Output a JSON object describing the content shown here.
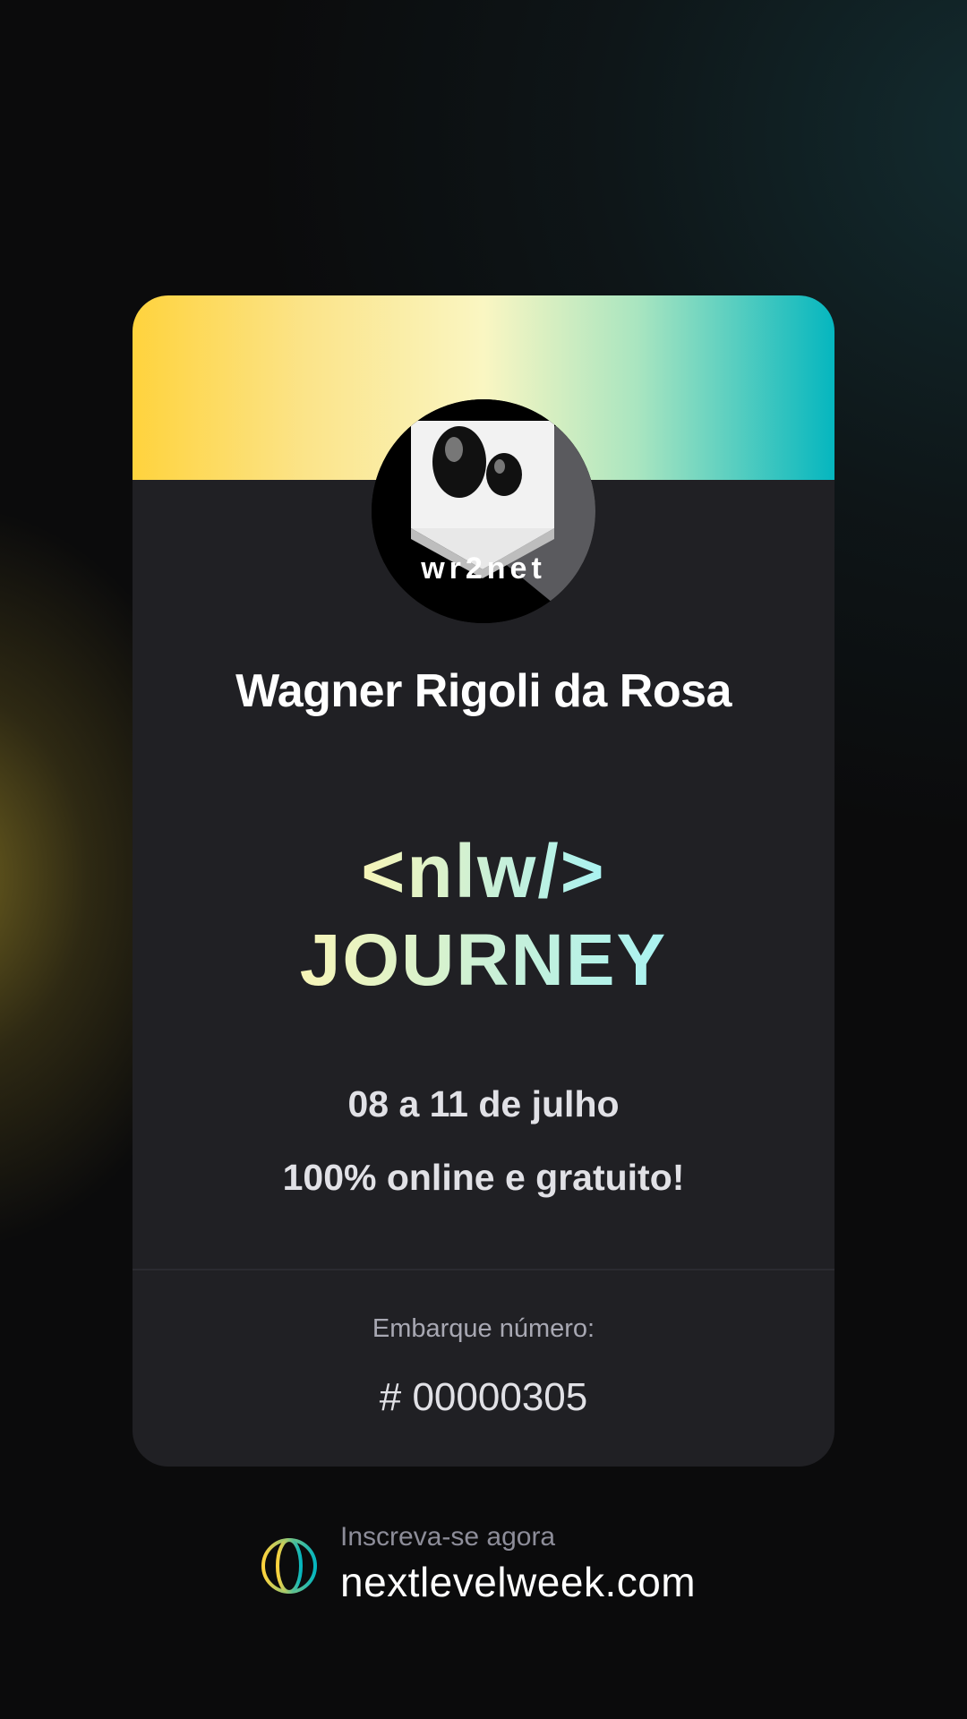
{
  "background": {
    "accent_yellow": "#FFD33D",
    "accent_teal": "#05B6BF",
    "card": "#202024"
  },
  "card": {
    "name": "Wagner Rigoli da Rosa",
    "avatar": {
      "icon": "wr2net-logo-icon",
      "text": "wr2net"
    },
    "event_logo": {
      "top": "<nlw/>",
      "bottom": "JOURNEY"
    },
    "dates": "08 a 11 de julho",
    "format": "100% online e gratuito!",
    "ticket_label": "Embarque número:",
    "ticket_number": "# 00000305"
  },
  "footer": {
    "icon": "globe-icon",
    "label": "Inscreva-se agora",
    "url": "nextlevelweek.com"
  }
}
